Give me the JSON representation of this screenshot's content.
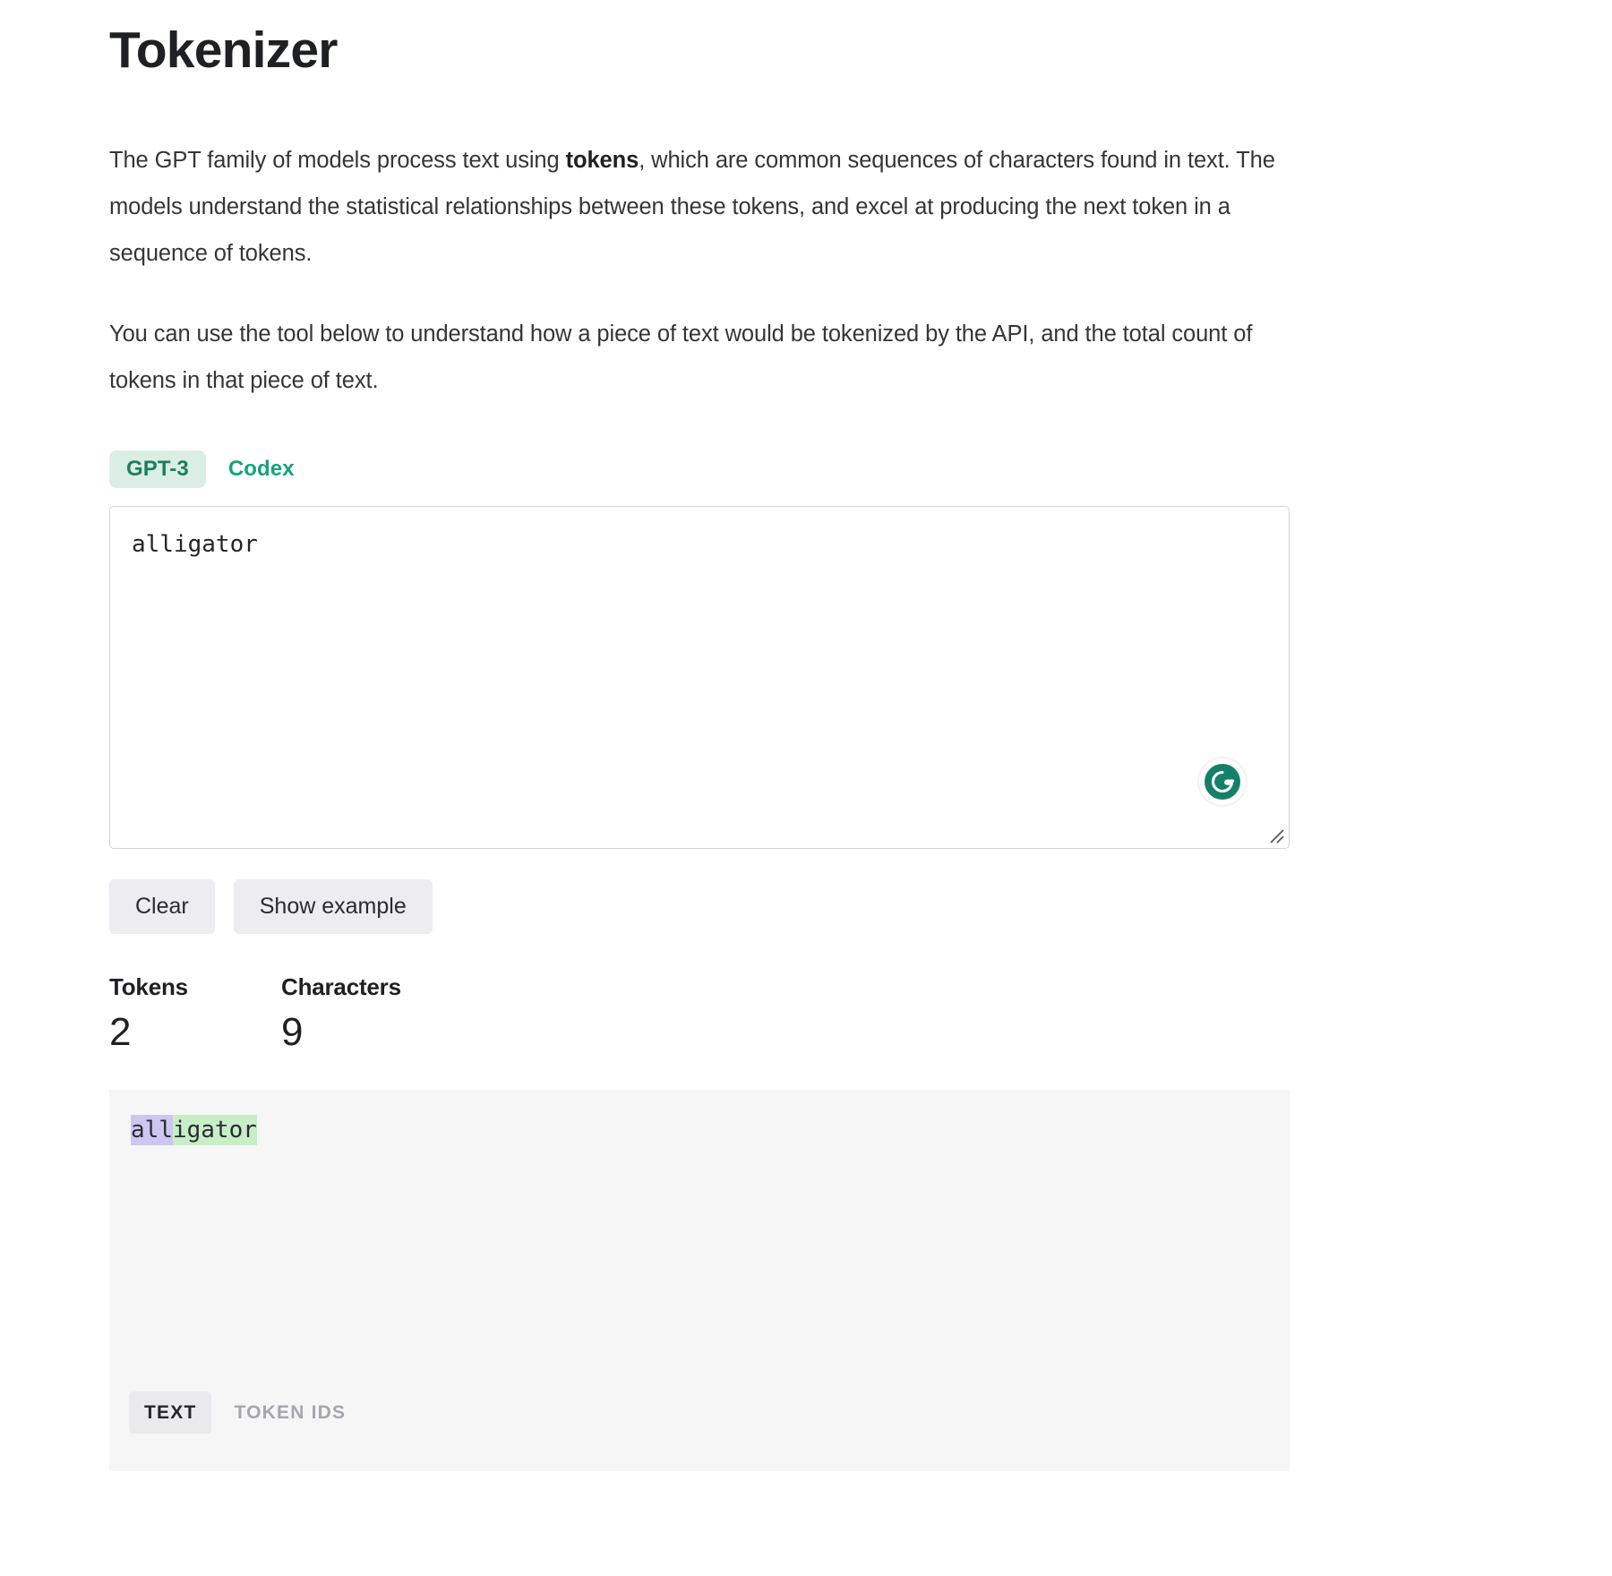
{
  "page": {
    "title": "Tokenizer"
  },
  "intro": {
    "paragraph1_before": "The GPT family of models process text using ",
    "paragraph1_bold": "tokens",
    "paragraph1_after": ", which are common sequences of characters found in text. The models understand the statistical relationships between these tokens, and excel at producing the next token in a sequence of tokens.",
    "paragraph2": "You can use the tool below to understand how a piece of text would be tokenized by the API, and the total count of tokens in that piece of text."
  },
  "model_tabs": {
    "items": [
      {
        "label": "GPT-3",
        "active": true
      },
      {
        "label": "Codex",
        "active": false
      }
    ]
  },
  "input": {
    "value": "alligator",
    "placeholder": "",
    "grammarly_icon": "grammarly-g-icon",
    "resize_icon": "resize-handle-icon"
  },
  "buttons": {
    "clear": "Clear",
    "show_example": "Show example"
  },
  "stats": {
    "tokens_label": "Tokens",
    "tokens_value": "2",
    "characters_label": "Characters",
    "characters_value": "9"
  },
  "output": {
    "tokens": [
      {
        "text": "all",
        "color": "#cdc6f0"
      },
      {
        "text": "igator",
        "color": "#c6efc8"
      }
    ],
    "tabs": [
      {
        "label": "TEXT",
        "active": true
      },
      {
        "label": "TOKEN IDS",
        "active": false
      }
    ]
  },
  "colors": {
    "accent_green": "#14a37c",
    "accent_green_dark": "#1a7f5f",
    "tab_active_bg": "#dbeee4",
    "button_bg": "#ececf1",
    "output_bg": "#f6f6f7",
    "token_purple": "#cdc6f0",
    "token_green": "#c6efc8",
    "grammarly_green": "#15806a"
  }
}
